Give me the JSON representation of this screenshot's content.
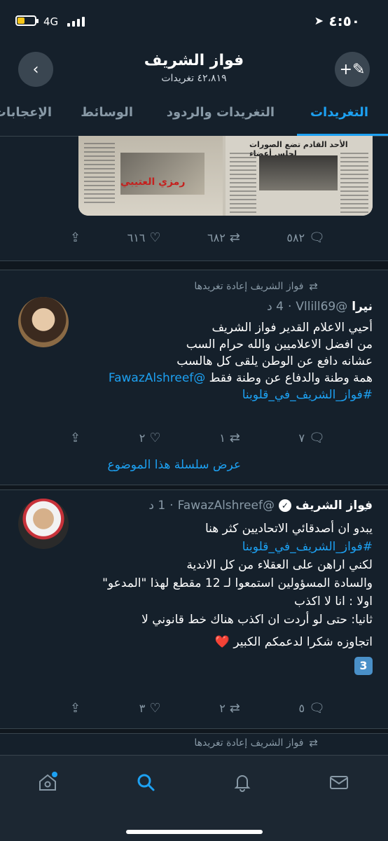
{
  "status_bar": {
    "time": "٤:٥٠",
    "network": "4G"
  },
  "header": {
    "title": "فواز الشريف",
    "subtitle": "٤٢،٨١٩ تغريدات"
  },
  "tabs": [
    {
      "label": "التغريدات",
      "active": true
    },
    {
      "label": "التغريدات والردود",
      "active": false
    },
    {
      "label": "الوسائط",
      "active": false
    },
    {
      "label": "الإعجابات",
      "active": false
    }
  ],
  "tweet1": {
    "image_caption": "رمزي العتيبي",
    "image_headline": "الأحد القادم تضع الصورات لجلس أعضاء",
    "replies": "٥٨٢",
    "retweets": "٦٨٢",
    "likes": "٦١٦"
  },
  "tweet2": {
    "retweeted_by": "فواز الشريف إعادة تغريدها",
    "name": "نيرا",
    "handle": "@Vllill69",
    "time": "4 د",
    "lines": [
      "أحيي الاعلام القدير فواز الشريف",
      "من افضل الاعلاميين والله حرام السب",
      "عشانه دافع عن الوطن يلقى كل هالسب",
      "همة وطنة والدفاع عن وطنة فقط"
    ],
    "mention": "@FawazAlshreef",
    "hashtag": "#فواز_الشريف_في_قلوبنا",
    "replies": "٧",
    "retweets": "١",
    "likes": "٢",
    "thread_link": "عرض سلسلة هذا الموضوع"
  },
  "tweet3": {
    "name": "فواز الشريف",
    "handle": "@FawazAlshreef",
    "time": "1 د",
    "line1": "يبدو ان أصدقائي الاتحاديين كثر هنا",
    "hashtag": "#فواز_الشريف_في_قلوبنا",
    "lines": [
      "لكني اراهن على العقلاء من كل الاندية",
      "والسادة المسؤولين استمعوا لـ 12 مقطع لهذا \"المدعو\"",
      "اولا : انا لا اكذب",
      "ثانيا: حتى لو أردت ان اكذب هناك خط قانوني لا",
      "اتجاوزه شكرا لدعمكم الكبير ❤️"
    ],
    "keycap": "3",
    "replies": "٥",
    "retweets": "٢",
    "likes": "٣"
  },
  "tweet4": {
    "retweeted_by": "فواز الشريف إعادة تغريدها"
  },
  "colors": {
    "background": "#15202b",
    "accent": "#1da1f2",
    "muted": "#8899a6",
    "heart": "#e0245e"
  }
}
